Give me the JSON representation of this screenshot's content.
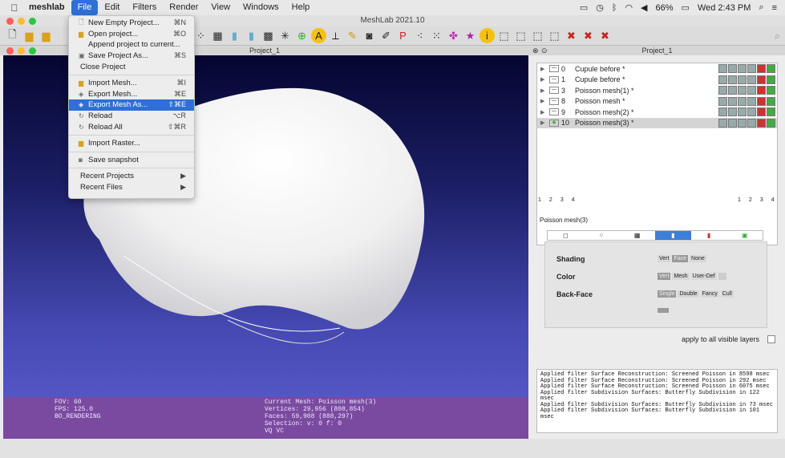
{
  "menubar": {
    "app": "meshlab",
    "items": [
      "File",
      "Edit",
      "Filters",
      "Render",
      "View",
      "Windows",
      "Help"
    ],
    "battery": "66%",
    "clock": "Wed 2:43 PM"
  },
  "window": {
    "title": "MeshLab 2021.10"
  },
  "viewport": {
    "title": "Project_1"
  },
  "rightpanel": {
    "title": "Project_1"
  },
  "filemenu": [
    {
      "label": "New Empty Project...",
      "shortcut": "⌘N"
    },
    {
      "label": "Open project...",
      "shortcut": "⌘O"
    },
    {
      "label": "Append project to current...",
      "shortcut": ""
    },
    {
      "label": "Save Project As...",
      "shortcut": "⌘S"
    },
    {
      "label": "Close Project",
      "shortcut": ""
    },
    {
      "label": "Import Mesh...",
      "shortcut": "⌘I"
    },
    {
      "label": "Export Mesh...",
      "shortcut": "⌘E"
    },
    {
      "label": "Export Mesh As...",
      "shortcut": "⇧⌘E"
    },
    {
      "label": "Reload",
      "shortcut": "⌥R"
    },
    {
      "label": "Reload All",
      "shortcut": "⇧⌘R"
    },
    {
      "label": "Import Raster...",
      "shortcut": ""
    },
    {
      "label": "Save snapshot",
      "shortcut": ""
    },
    {
      "label": "Recent Projects",
      "shortcut": "▶"
    },
    {
      "label": "Recent Files",
      "shortcut": "▶"
    }
  ],
  "layers": [
    {
      "num": "0",
      "name": "Cupule before *"
    },
    {
      "num": "1",
      "name": "Cupule before *"
    },
    {
      "num": "3",
      "name": "Poisson mesh(1) *"
    },
    {
      "num": "8",
      "name": "Poisson mesh *"
    },
    {
      "num": "9",
      "name": "Poisson mesh(2) *"
    },
    {
      "num": "10",
      "name": "Poisson mesh(3) *"
    }
  ],
  "pages": [
    "1",
    "2",
    "3",
    "4"
  ],
  "current_mesh_label": "Poisson mesh(3)",
  "render_props": {
    "shading_label": "Shading",
    "shading_opts": [
      "Vert",
      "Face",
      "None"
    ],
    "color_label": "Color",
    "color_opts": [
      "Vert",
      "Mesh",
      "User-Def"
    ],
    "backface_label": "Back-Face",
    "backface_opts": [
      "Single",
      "Double",
      "Fancy",
      "Cull"
    ]
  },
  "apply_all": "apply to all visible layers",
  "log": "Applied filter Surface Reconstruction: Screened Poisson in 8598 msec\nApplied filter Surface Reconstruction: Screened Poisson in 292 msec\nApplied filter Surface Reconstruction: Screened Poisson in 6075 msec\nApplied filter Subdivision Surfaces: Butterfly Subdivision in 122 msec\nApplied filter Subdivision Surfaces: Butterfly Subdivision in 73 msec\nApplied filter Subdivision Surfaces: Butterfly Subdivision in 101 msec",
  "info": {
    "fov": "FOV: 60",
    "fps": "FPS:  125.0",
    "mode": "BO_RENDERING",
    "current": "Current Mesh: Poisson mesh(3)",
    "vertices": "Vertices: 29,956   (808,854)",
    "faces": "Faces: 59,908   (888,297)",
    "selection": "Selection: v: 0 f: 0",
    "vq": "VQ VC"
  }
}
